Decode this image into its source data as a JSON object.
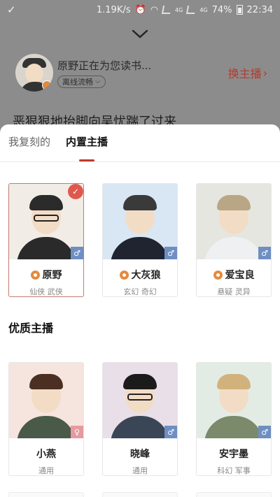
{
  "status_bar": {
    "left_icon": "checkmark-swoosh-icon",
    "speed": "1.19K/s",
    "network_labels": [
      "4G",
      "4G"
    ],
    "battery": "74%",
    "time": "22:34"
  },
  "player": {
    "collapse_icon": "chevron-down-icon",
    "reader_text": "原野正在为您读书...",
    "quality_label": "离线流畅",
    "switch_label": "换主播",
    "book_text": "恶狠狠地抬脚向吴忧踹了过来"
  },
  "sheet": {
    "tabs": [
      {
        "label": "我复刻的",
        "active": false
      },
      {
        "label": "内置主播",
        "active": true
      }
    ],
    "builtin": [
      {
        "name": "原野",
        "tags": "仙侠 武侠",
        "gender": "male",
        "selected": true,
        "hair": "#2b2b2b",
        "torso": "#2a2a2a",
        "bg": "#f1ece6",
        "glasses": true
      },
      {
        "name": "大灰狼",
        "tags": "玄幻 奇幻",
        "gender": "male",
        "selected": false,
        "hair": "#3a3a3a",
        "torso": "#1f2430",
        "bg": "#d9e6f4",
        "glasses": false
      },
      {
        "name": "爱宝良",
        "tags": "悬疑 灵异",
        "gender": "male",
        "selected": false,
        "hair": "#b9a685",
        "torso": "#eef0f2",
        "bg": "#e6e6e0",
        "glasses": false
      }
    ],
    "section_title": "优质主播",
    "quality": [
      {
        "name": "小燕",
        "tags": "通用",
        "gender": "female",
        "hair": "#4a2f22",
        "torso": "#4a5a48",
        "bg": "#f6e4df",
        "glasses": false
      },
      {
        "name": "晓峰",
        "tags": "通用",
        "gender": "male",
        "hair": "#1b1b1b",
        "torso": "#3a4656",
        "bg": "#e9dfe8",
        "glasses": true
      },
      {
        "name": "安宇墨",
        "tags": "科幻 军事",
        "gender": "male",
        "hair": "#d2b27c",
        "torso": "#7a8a6a",
        "bg": "#e3ece4",
        "glasses": false
      }
    ]
  },
  "colors": {
    "accent": "#c0392b",
    "medal": "#e58a3f",
    "male_badge": "#6f8fc3",
    "female_badge": "#e59aa0"
  }
}
